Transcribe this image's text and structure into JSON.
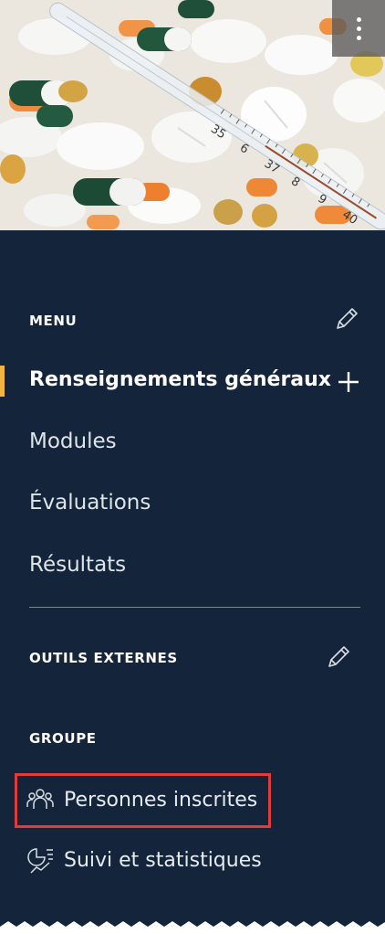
{
  "hero": {
    "thermometer_numbers": [
      "35",
      "6",
      "37",
      "8",
      "9",
      "40"
    ]
  },
  "menu": {
    "title": "MENU",
    "items": [
      {
        "label": "Renseignements généraux",
        "active": true
      },
      {
        "label": "Modules",
        "active": false
      },
      {
        "label": "Évaluations",
        "active": false
      },
      {
        "label": "Résultats",
        "active": false
      }
    ]
  },
  "external_tools": {
    "title": "OUTILS EXTERNES"
  },
  "group": {
    "title": "GROUPE",
    "items": [
      {
        "label": "Personnes inscrites",
        "icon": "people-icon"
      },
      {
        "label": "Suivi et statistiques",
        "icon": "statistics-icon"
      }
    ]
  },
  "colors": {
    "panel_bg": "#14243a",
    "active_indicator": "#f2b544",
    "highlight_border": "#e23b3b"
  }
}
